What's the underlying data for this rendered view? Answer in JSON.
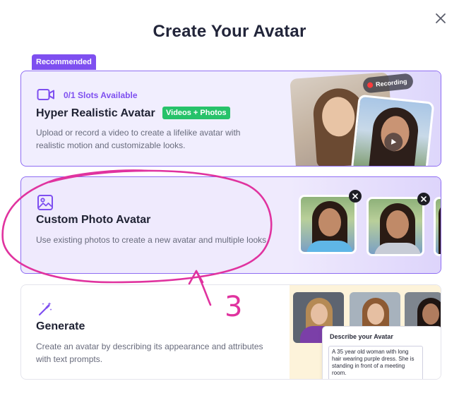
{
  "modal": {
    "title": "Create Your Avatar",
    "close_icon": "close-icon"
  },
  "hyper_realistic": {
    "badge": "Recommended",
    "icon": "video-camera-icon",
    "slots": "0/1 Slots Available",
    "title": "Hyper Realistic Avatar",
    "tag": "Videos + Photos",
    "description": "Upload or record a video to create a lifelike avatar with realistic motion and customizable looks.",
    "recording_label": "Recording"
  },
  "custom_photo": {
    "icon": "image-icon",
    "title": "Custom Photo Avatar",
    "description": "Use existing photos to create a new avatar and multiple looks."
  },
  "generate": {
    "icon": "magic-wand-icon",
    "title": "Generate",
    "description": "Create an avatar by describing its appearance and attributes with text prompts.",
    "describe_title": "Describe your Avatar",
    "describe_text": "A 35 year old woman with long hair wearing purple dress. She is standing in front of a meeting room."
  },
  "annotation": {
    "label": "3",
    "color": "#e0339f"
  },
  "colors": {
    "accent": "#7e4ff0",
    "tag_green": "#27c26a",
    "card_border": "#8f6df3"
  }
}
